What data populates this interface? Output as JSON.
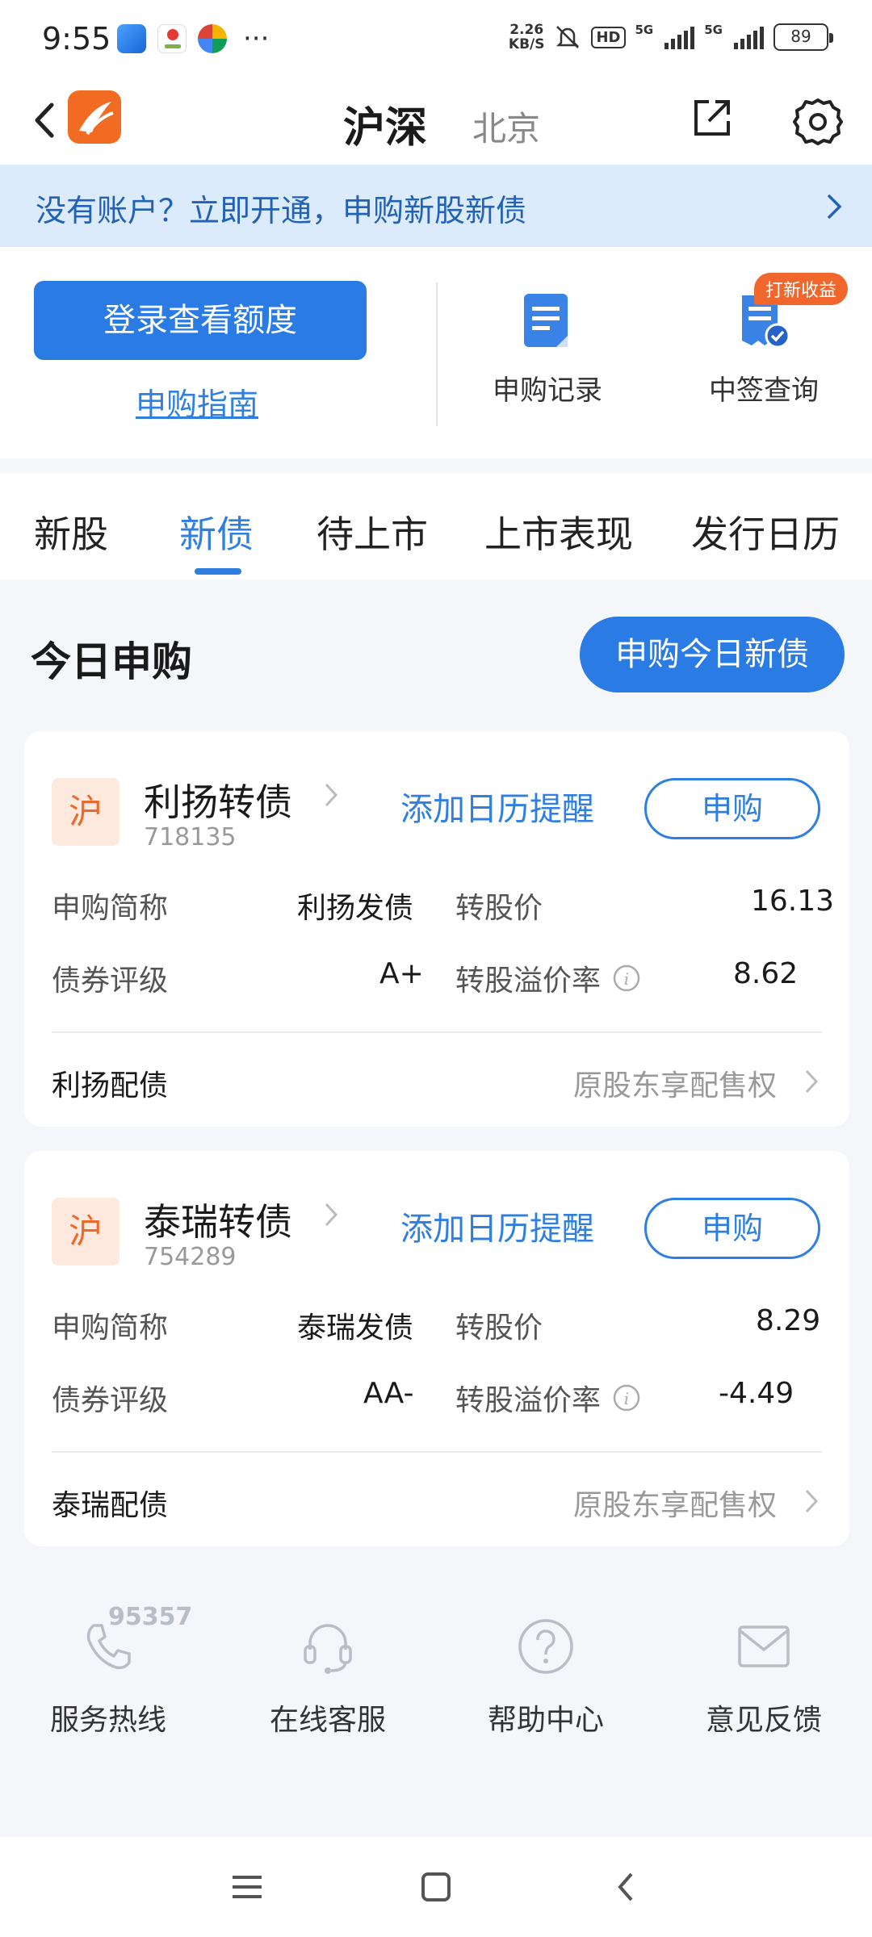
{
  "status_bar": {
    "time": "9:55",
    "speed_value": "2.26",
    "speed_unit": "KB/S",
    "hd": "HD",
    "net1": "5G",
    "net2": "5G",
    "battery": "89",
    "more": "···"
  },
  "header": {
    "title": "沪深",
    "subtitle": "北京"
  },
  "banner": {
    "text": "没有账户？立即开通，申购新股新债"
  },
  "login": {
    "button": "登录查看额度",
    "guide": "申购指南",
    "record": "申购记录",
    "lottery": "中签查询",
    "badge": "打新收益"
  },
  "tabs": [
    "新股",
    "新债",
    "待上市",
    "上市表现",
    "发行日历"
  ],
  "section": {
    "title": "今日申购",
    "button": "申购今日新债"
  },
  "bonds": [
    {
      "market": "沪",
      "name": "利扬转债",
      "code": "718135",
      "calendar": "添加日历提醒",
      "buy": "申购",
      "short_label": "申购简称",
      "short_value": "利扬发债",
      "conv_label": "转股价",
      "conv_value": "16.13",
      "rating_label": "债券评级",
      "rating_value": "A+",
      "premium_label": "转股溢价率",
      "premium_value": "8.62",
      "placing": "利扬配债",
      "right": "原股东享配售权"
    },
    {
      "market": "沪",
      "name": "泰瑞转债",
      "code": "754289",
      "calendar": "添加日历提醒",
      "buy": "申购",
      "short_label": "申购简称",
      "short_value": "泰瑞发债",
      "conv_label": "转股价",
      "conv_value": "8.29",
      "rating_label": "债券评级",
      "rating_value": "AA-",
      "premium_label": "转股溢价率",
      "premium_value": "-4.49",
      "placing": "泰瑞配债",
      "right": "原股东享配售权"
    }
  ],
  "services": {
    "hotline_number": "95357",
    "items": [
      "服务热线",
      "在线客服",
      "帮助中心",
      "意见反馈"
    ]
  },
  "colors": {
    "accent": "#2b7be4",
    "orange": "#f26b22",
    "banner_bg": "#dcebfb"
  }
}
